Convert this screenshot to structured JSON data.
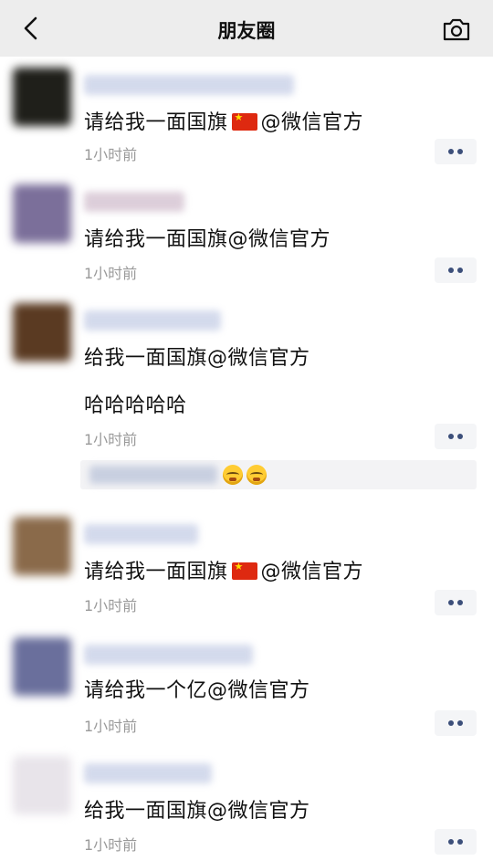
{
  "nav": {
    "title": "朋友圈"
  },
  "posts": [
    {
      "text": "请给我一面国旗",
      "mention": "@微信官方",
      "flag": true,
      "time": "1小时前"
    },
    {
      "text": "请给我一面国旗",
      "mention": "@微信官方",
      "flag": false,
      "time": "1小时前"
    },
    {
      "text": "给我一面国旗",
      "mention": "@微信官方",
      "extra": "哈哈哈哈哈",
      "flag": false,
      "time": "1小时前",
      "likes": 2
    },
    {
      "text": "请给我一面国旗",
      "mention": "@微信官方",
      "flag": true,
      "time": "1小时前"
    },
    {
      "text": "请给我一个亿",
      "mention": "@微信官方",
      "flag": false,
      "time": "1小时前"
    },
    {
      "text": "给我一面国旗",
      "mention": "@微信官方",
      "flag": false,
      "time": "1小时前"
    }
  ],
  "colors": {
    "nav_bg": "#ededed",
    "time_text": "#9a9a9a",
    "more_dots": "#3c4f7a",
    "flag": "#de2910"
  },
  "icons": {
    "back": "chevron-left-icon",
    "camera": "camera-icon",
    "more": "more-dots-icon",
    "like": "emoji-face-icon"
  }
}
